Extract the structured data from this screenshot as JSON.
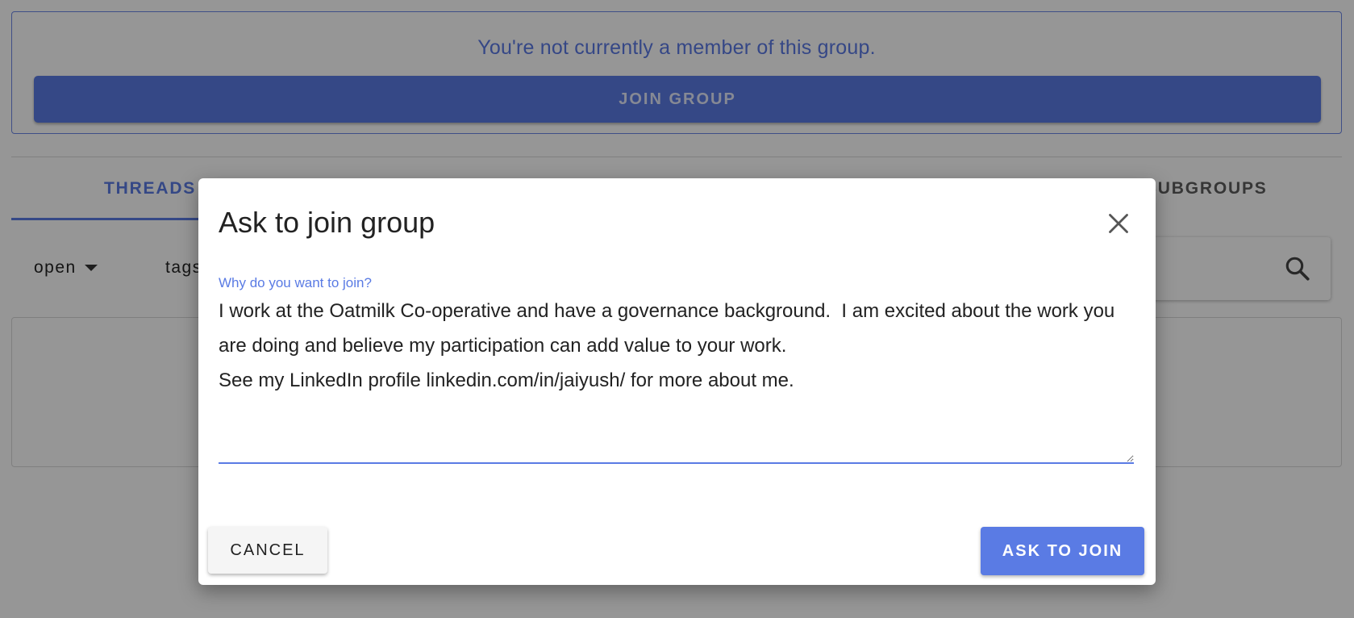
{
  "colors": {
    "accent": "#5a7be4",
    "overlay": "rgba(0,0,0,0.41)"
  },
  "notice": {
    "text": "You're not currently a member of this group.",
    "join_button_label": "JOIN GROUP"
  },
  "tabs": {
    "threads_label": "THREADS",
    "subgroups_label": "SUBGROUPS"
  },
  "filters": {
    "status_label": "open",
    "tags_label": "tags"
  },
  "search": {
    "icon": "search-icon"
  },
  "dialog": {
    "title": "Ask to join group",
    "close_icon": "close-icon",
    "field_label": "Why do you want to join?",
    "field_value": "I work at the Oatmilk Co-operative and have a governance background.  I am excited about the work you are doing and believe my participation can add value to your work.\nSee my LinkedIn profile linkedin.com/in/jaiyush/ for more about me.",
    "cancel_label": "CANCEL",
    "submit_label": "ASK TO JOIN"
  }
}
